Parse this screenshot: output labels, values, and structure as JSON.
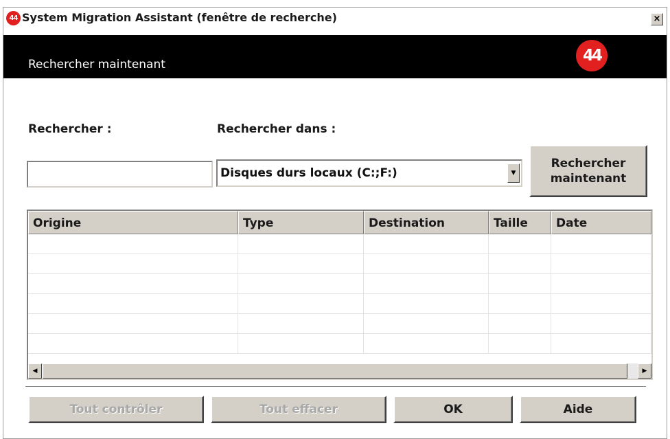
{
  "window": {
    "title": "System Migration Assistant (fenêtre de recherche)",
    "app_icon": "44",
    "close_glyph": "×"
  },
  "banner": {
    "title": "Rechercher maintenant",
    "logo": "44"
  },
  "search": {
    "label": "Rechercher :",
    "value": "",
    "placeholder": ""
  },
  "search_in": {
    "label": "Rechercher dans :",
    "value": "Disques durs locaux (C:;F:)"
  },
  "search_button": {
    "line1": "Rechercher",
    "line2": "maintenant"
  },
  "table": {
    "columns": [
      "Origine",
      "Type",
      "Destination",
      "Taille",
      "Date"
    ],
    "rows": [
      [],
      [],
      [],
      [],
      [],
      []
    ]
  },
  "footer": {
    "check_all": "Tout contrôler",
    "clear_all": "Tout effacer",
    "ok": "OK",
    "help": "Aide"
  },
  "colors": {
    "banner": "#000000",
    "brand_red": "#e1201f",
    "button_face": "#d4d0c8",
    "disabled_text": "#a8a8a8"
  },
  "icons": {
    "app": "ibm-44-logo-icon",
    "close": "close-icon",
    "dropdown": "chevron-down-icon",
    "scroll_left": "arrow-left-icon",
    "scroll_right": "arrow-right-icon"
  }
}
